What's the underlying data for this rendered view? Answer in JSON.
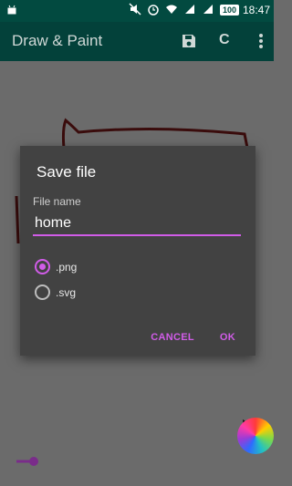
{
  "status_bar": {
    "battery": "100",
    "time": "18:47",
    "icons": [
      "android-icon",
      "mute-icon",
      "alarm-icon",
      "wifi-icon",
      "signal-icon",
      "signal-icon-2"
    ]
  },
  "toolbar": {
    "title": "Draw & Paint",
    "save_icon": "save-icon",
    "c_label": "C",
    "more_icon": "more-vertical-icon"
  },
  "dialog": {
    "title": "Save file",
    "field_label": "File name",
    "field_value": "home",
    "options": [
      {
        "label": ".png",
        "checked": true
      },
      {
        "label": ".svg",
        "checked": false
      }
    ],
    "cancel_label": "CANCEL",
    "ok_label": "OK"
  },
  "colors": {
    "accent": "#d15ce8",
    "toolbar": "#03413a",
    "status_bar": "#024a40",
    "dialog": "#424242",
    "canvas": "#6b6b6b",
    "stroke": "#3a0c0c"
  }
}
